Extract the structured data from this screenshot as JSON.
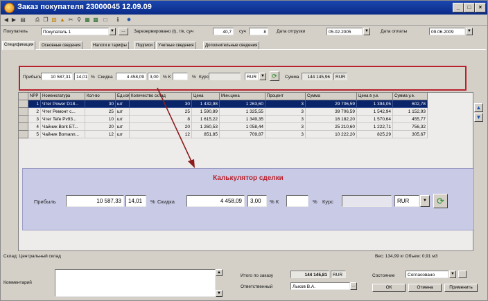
{
  "window": {
    "title": "Заказ покупателя 23000045 12.09.09",
    "controls": [
      "_",
      "□",
      "×"
    ]
  },
  "toolbar": {
    "icons": [
      "back-icon",
      "forward-icon",
      "doc-icon",
      "print-icon",
      "copy-icon",
      "paste-icon",
      "folder-icon",
      "cut-icon",
      "find-icon",
      "report-icon",
      "calc-icon",
      "chart-icon",
      "info-icon",
      "settings-icon"
    ]
  },
  "header": {
    "customer_label": "Покупатель",
    "customer_value": "Покупатель 1",
    "reserved_label": "Зарезервировано (t), т/к, суч",
    "reserved_value": "40,7",
    "ruch_label": "суч",
    "ruch_value": "8",
    "ship_date_label": "Дата отгрузки",
    "ship_date_value": "05.02.2005",
    "pay_date_label": "Дата оплаты",
    "pay_date_value": "09.06.2009"
  },
  "tabs": [
    "Спецификация",
    "Основные сведения",
    "Налоги и тарифы",
    "Подписи",
    "Учетные сведения",
    "Дополнительные сведения"
  ],
  "calc_small": {
    "profit_label": "Прибыль",
    "profit_value": "10 587,31",
    "profit_pct": "14,01",
    "pct_label": "%",
    "discount_label": "Скидка",
    "discount_value": "4 458,09",
    "discount_pct": "3,00",
    "pct_k_label": "% К",
    "k_value": "",
    "pct2_label": "%",
    "kurs_label": "Курс",
    "kurs_value": "",
    "currency_value": "RUR",
    "sum_label": "Сумма",
    "sum_value": "144 145,96",
    "sum_currency": "RUR"
  },
  "grid": {
    "columns": [
      "NPP",
      "Номенклатура",
      "Кол-во",
      "Ед.изм",
      "Количество склад",
      "Цена",
      "Мин.цена",
      "Процент",
      "Сумма",
      "Цена в у.е.",
      "Сумма у.е."
    ],
    "rows": [
      {
        "npp": "1",
        "name": "Чтег Power D18...",
        "qty": "30",
        "unit": "шт",
        "stock": "30",
        "price": "1 432,98",
        "minprice": "1 263,60",
        "pct": "3",
        "sum": "29 706,59",
        "price_ue": "1 394,05",
        "sum_ue": "602,78"
      },
      {
        "npp": "2",
        "name": "Чтег Ремонт с...",
        "qty": "25",
        "unit": "шт",
        "stock": "25",
        "price": "1 590,89",
        "minprice": "1 325,55",
        "pct": "3",
        "sum": "39 706,59",
        "price_ue": "1 542,94",
        "sum_ue": "1 152,93"
      },
      {
        "npp": "3",
        "name": "Чтег Tefe Pv93...",
        "qty": "10",
        "unit": "шт",
        "stock": "8",
        "price": "1 615,22",
        "minprice": "1 349,35",
        "pct": "3",
        "sum": "16 182,20",
        "price_ue": "1 570,64",
        "sum_ue": "455,77"
      },
      {
        "npp": "4",
        "name": "Чайник Bork ET...",
        "qty": "20",
        "unit": "шт",
        "stock": "20",
        "price": "1 260,53",
        "minprice": "1 058,44",
        "pct": "3",
        "sum": "25 210,60",
        "price_ue": "1 222,71",
        "sum_ue": "756,32"
      },
      {
        "npp": "5",
        "name": "Чайник Bomann...",
        "qty": "12",
        "unit": "шт",
        "stock": "12",
        "price": "851,85",
        "minprice": "709,87",
        "pct": "3",
        "sum": "10 222,20",
        "price_ue": "825,29",
        "sum_ue": "305,67"
      }
    ]
  },
  "zoom": {
    "title": "Калькулятор сделки",
    "profit_label": "Прибыль",
    "profit_value": "10 587,33",
    "profit_pct": "14,01",
    "pct_label": "%",
    "discount_label": "Скидка",
    "discount_value": "4 458,09",
    "discount_pct": "3,00",
    "pct_k_label": "% К",
    "k_value": "",
    "pct2_label": "%",
    "kurs_label": "Курс",
    "kurs_value": "",
    "currency_value": "RUR"
  },
  "status": {
    "warehouse": "Склад: Центральный склад",
    "weight": "Вес: 134,99 кг  Объем: 0,91 м3"
  },
  "bottom": {
    "comment_label": "Комментарий",
    "comment_value": "",
    "total_label": "Итого по заказу",
    "total_value": "144 145,81",
    "total_currency": "RUR",
    "responsible_label": "Ответственный",
    "responsible_value": "Лыков В.А.",
    "state_label": "Состояние",
    "state_value": "Согласовано",
    "ok_label": "ОК",
    "cancel_label": "Отмена",
    "apply_label": "Применить"
  },
  "colors": {
    "title_bg": "#0a2a86",
    "highlight_border": "#b7212d",
    "selection": "#0a246a",
    "zoom_bg": "#c9cbe6",
    "arrow": "#8b1d1d"
  }
}
